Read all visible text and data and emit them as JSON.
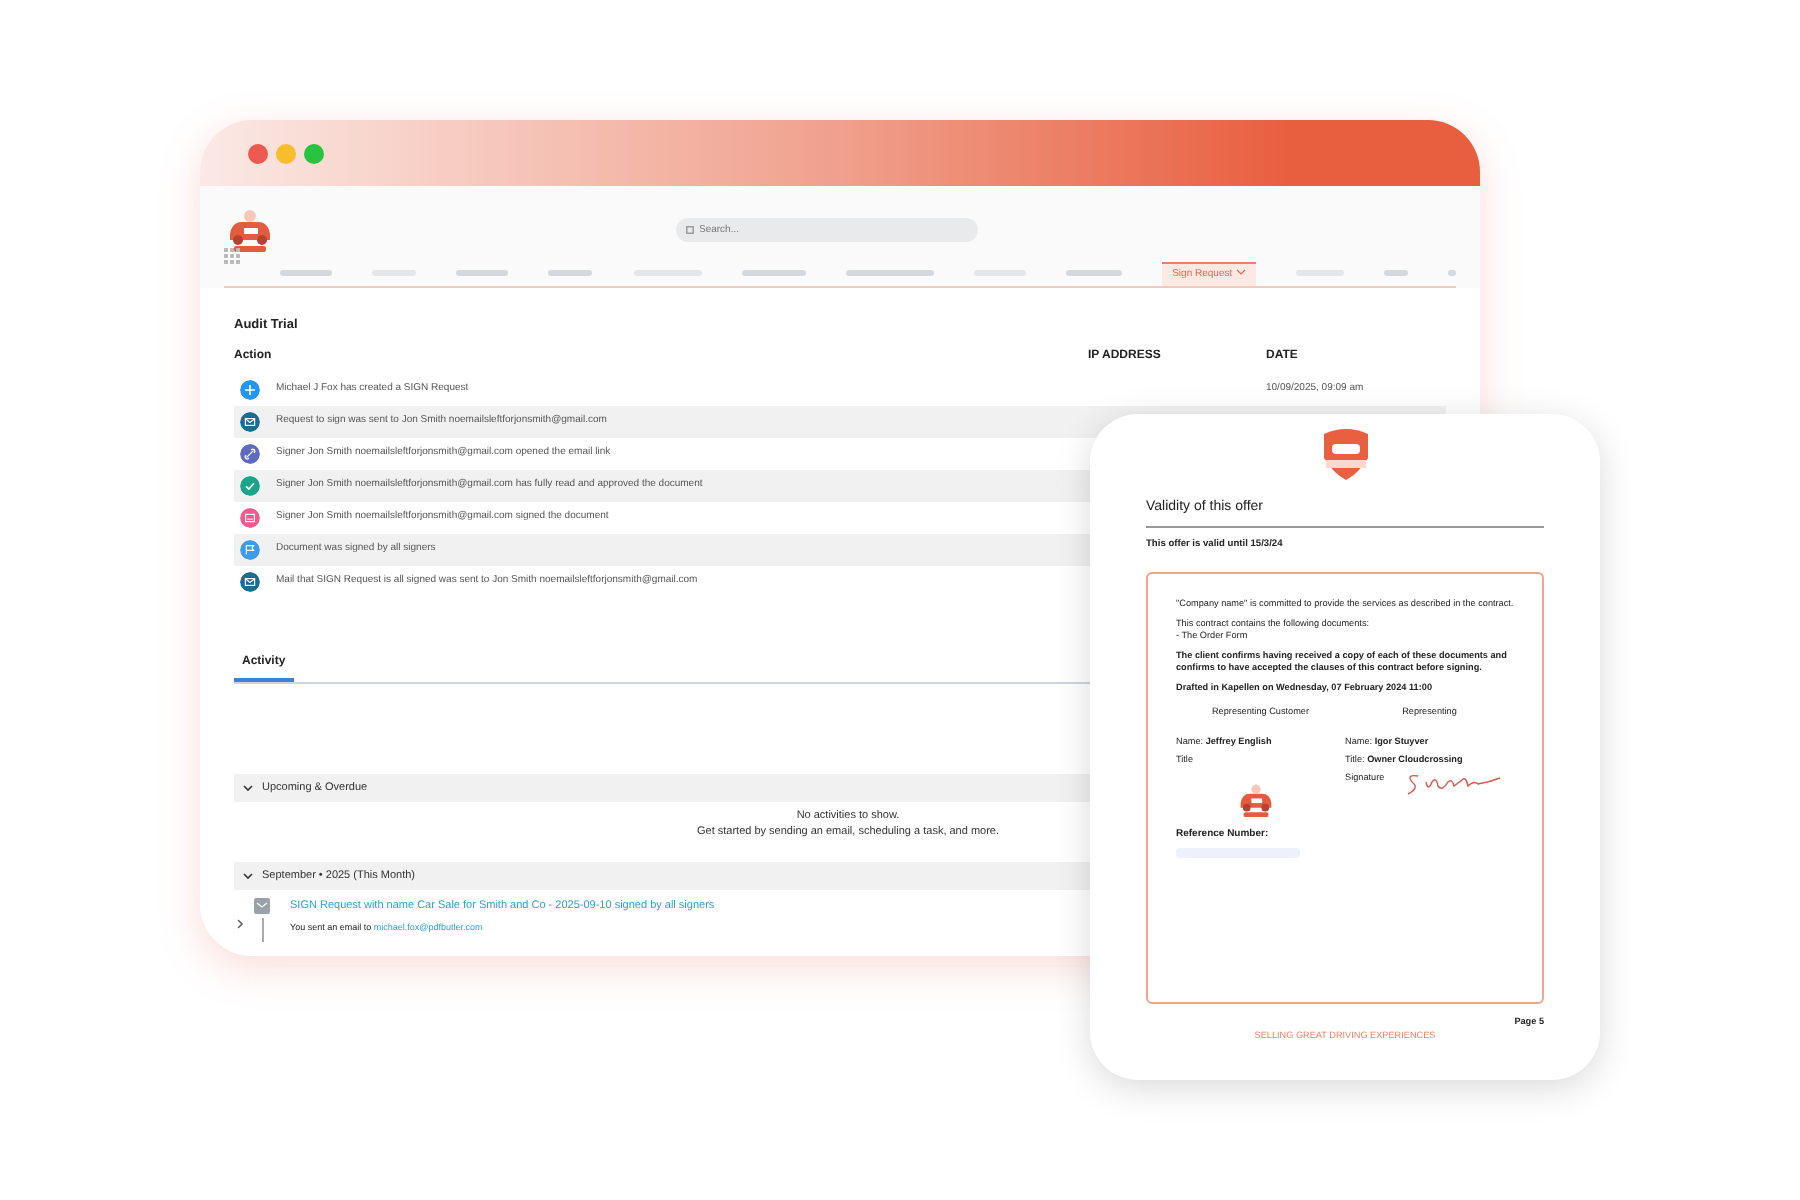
{
  "app_window": {
    "search": {
      "placeholder": "Search..."
    },
    "nav": [
      {
        "kind": "placeholder"
      },
      {
        "kind": "placeholder"
      },
      {
        "kind": "placeholder"
      },
      {
        "kind": "placeholder"
      },
      {
        "kind": "placeholder"
      },
      {
        "kind": "placeholder"
      },
      {
        "kind": "placeholder"
      },
      {
        "kind": "placeholder"
      },
      {
        "kind": "placeholder"
      },
      {
        "kind": "tab",
        "label": "Sign Request",
        "selected": true
      },
      {
        "kind": "placeholder"
      },
      {
        "kind": "placeholder"
      },
      {
        "kind": "placeholder"
      }
    ],
    "audit": {
      "title": "Audit Trial",
      "columns": [
        "Action",
        "IP ADDRESS",
        "DATE"
      ],
      "rows": [
        {
          "kind": "plus",
          "color": "#2196f3",
          "text": "Michael J Fox has created a SIGN Request",
          "date": "10/09/2025, 09:09 am"
        },
        {
          "kind": "mail",
          "color": "#1b6b93",
          "text": "Request to sign was sent to Jon Smith noemailsleftforjonsmith@gmail.com"
        },
        {
          "kind": "link",
          "color": "#5c6bc0",
          "text": "Signer Jon Smith noemailsleftforjonsmith@gmail.com opened the email link"
        },
        {
          "kind": "check",
          "color": "#1aa58a",
          "text": "Signer Jon Smith noemailsleftforjonsmith@gmail.com has fully read and approved the document"
        },
        {
          "kind": "sign",
          "color": "#ef5b8c",
          "text": "Signer Jon Smith noemailsleftforjonsmith@gmail.com signed the document"
        },
        {
          "kind": "flag",
          "color": "#3d9be9",
          "text": "Document was signed by all signers"
        },
        {
          "kind": "mail",
          "color": "#1b6b93",
          "text": "Mail that SIGN Request is all signed was sent to Jon Smith noemailsleftforjonsmith@gmail.com"
        }
      ]
    },
    "activity": {
      "tabs": [
        {
          "label": "Activity",
          "selected": true
        }
      ],
      "sections": [
        {
          "label": "Upcoming & Overdue",
          "expanded": true,
          "empty_message": [
            "No activities to show.",
            "Get started by sending an email, scheduling a task, and more."
          ]
        },
        {
          "label": "September • 2025 (This Month)",
          "expanded": true,
          "items": [
            {
              "expanded": false,
              "title": "SIGN Request with name Car Sale for Smith and Co - 2025-09-10 signed by all signers",
              "detail": "You sent an email to",
              "email": "michael.fox@pdfbutler.com"
            }
          ]
        }
      ]
    }
  },
  "document": {
    "heading": "Validity of this offer",
    "validity": "This offer is valid until 15/3/24",
    "paragraphs": [
      {
        "kind": "plain",
        "text": "\"Company name\" is committed to provide the services as described in the contract."
      },
      {
        "kind": "plain",
        "text": "This contract contains the following documents:",
        "sub": "- The Order Form"
      },
      {
        "kind": "bold",
        "text": "The client confirms having received a copy of each of these documents and confirms to have accepted the clauses of this contract before signing."
      },
      {
        "kind": "bold",
        "text": "Drafted in Kapellen on Wednesday, 07 February 2024 11:00"
      }
    ],
    "parties": [
      {
        "heading": "Representing Customer",
        "lines": [
          "Name: **Jeffrey English**",
          "Title"
        ],
        "kind": "logo"
      },
      {
        "heading": "Representing",
        "lines": [
          "Name: **Igor Stuyver**",
          "Title: **Owner Cloudcrossing**",
          "Signature"
        ],
        "kind": "signature"
      }
    ],
    "reference_label": "Reference Number:",
    "page": "Page 5",
    "tagline": "SELLING GREAT DRIVING EXPERIENCES"
  }
}
